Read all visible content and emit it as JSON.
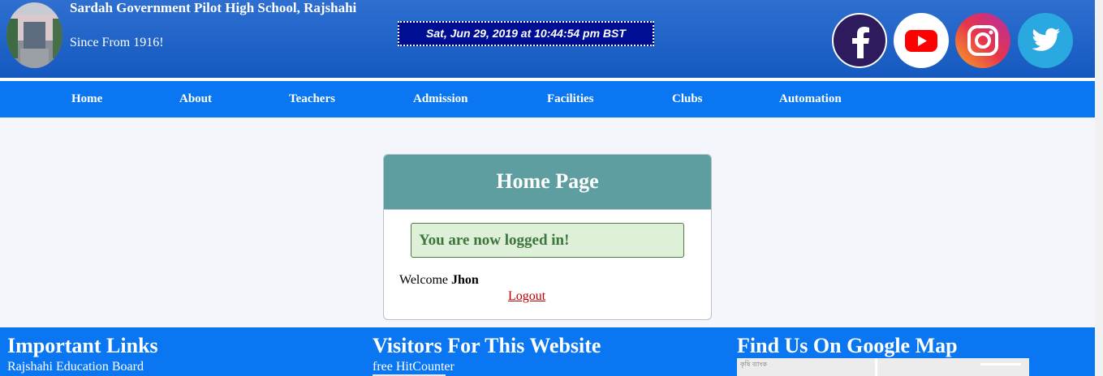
{
  "header": {
    "school_name": "Sardah Government Pilot High School, Rajshahi",
    "since": "Since From 1916!",
    "datetime": "Sat, Jun 29, 2019 at 10:44:54 pm BST",
    "social": [
      "facebook-icon",
      "youtube-icon",
      "instagram-icon",
      "twitter-icon"
    ]
  },
  "nav": {
    "items": [
      "Home",
      "About",
      "Teachers",
      "Admission",
      "Facilities",
      "Clubs",
      "Automation"
    ]
  },
  "card": {
    "title": "Home Page",
    "alert": "You are now logged in!",
    "welcome_label": "Welcome",
    "username": "Jhon",
    "logout": "Logout"
  },
  "footer": {
    "links_heading": "Important Links",
    "links": [
      "Rajshahi Education Board"
    ],
    "visitors_heading": "Visitors For This Website",
    "counter_label": "free HitCounter",
    "map_heading": "Find Us On Google Map",
    "map_label": "কৃষি ব্যাংক"
  },
  "colors": {
    "header_bg": "#1f63c9",
    "nav_bg": "#0b76f2",
    "card_head": "#5f9ea0",
    "alert_bg": "#dff0d8",
    "alert_text": "#3c763d",
    "logout_link": "#c00000"
  }
}
